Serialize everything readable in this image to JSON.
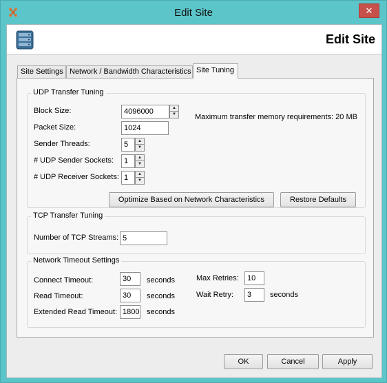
{
  "window": {
    "title": "Edit Site",
    "close_glyph": "✕",
    "app_icon": "app-logo-icon"
  },
  "header": {
    "title": "Edit Site",
    "icon": "server-icon"
  },
  "tabs": [
    {
      "label": "Site Settings",
      "active": false
    },
    {
      "label": "Network / Bandwidth Characteristics",
      "active": false
    },
    {
      "label": "Site Tuning",
      "active": true
    }
  ],
  "udp": {
    "title": "UDP Transfer Tuning",
    "block_size": {
      "label": "Block Size:",
      "value": "4096000"
    },
    "packet_size": {
      "label": "Packet Size:",
      "value": "1024"
    },
    "sender_threads": {
      "label": "Sender Threads:",
      "value": "5"
    },
    "udp_sender_sockets": {
      "label": "# UDP Sender Sockets:",
      "value": "1"
    },
    "udp_receiver_sockets": {
      "label": "# UDP Receiver Sockets:",
      "value": "1"
    },
    "memory_note": "Maximum transfer memory requirements: 20 MB",
    "optimize_button": "Optimize Based on Network Characteristics",
    "restore_button": "Restore Defaults"
  },
  "tcp": {
    "title": "TCP Transfer Tuning",
    "streams": {
      "label": "Number of TCP Streams:",
      "value": "5"
    }
  },
  "timeout": {
    "title": "Network Timeout Settings",
    "connect": {
      "label": "Connect Timeout:",
      "value": "30",
      "unit": "seconds"
    },
    "read": {
      "label": "Read Timeout:",
      "value": "30",
      "unit": "seconds"
    },
    "extended_read": {
      "label": "Extended Read Timeout:",
      "value": "1800",
      "unit": "seconds"
    },
    "max_retries": {
      "label": "Max Retries:",
      "value": "10"
    },
    "wait_retry": {
      "label": "Wait Retry:",
      "value": "3",
      "unit": "seconds"
    }
  },
  "footer": {
    "ok": "OK",
    "cancel": "Cancel",
    "apply": "Apply"
  },
  "colors": {
    "titlebar": "#5cc5c9",
    "close": "#c7514a",
    "panel": "#f7f7f7"
  }
}
